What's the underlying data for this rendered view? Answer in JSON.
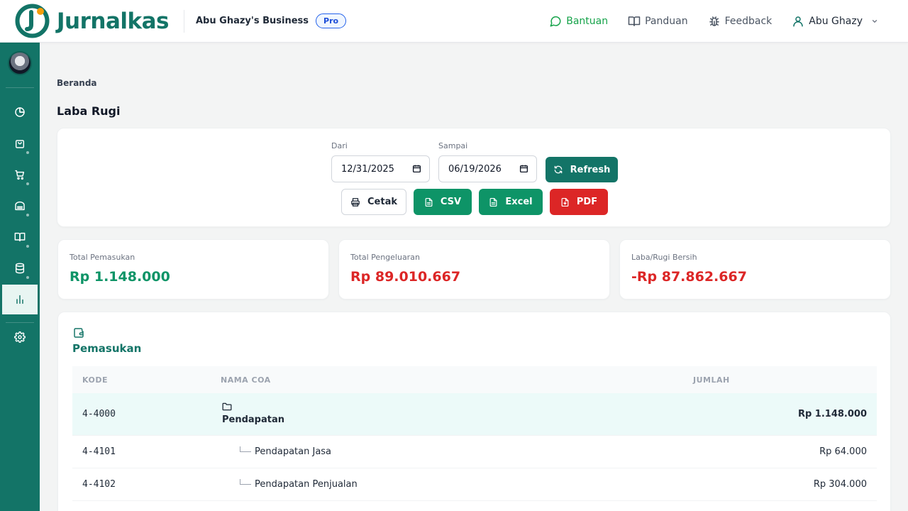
{
  "brand": {
    "name": "Jurnalkas"
  },
  "header": {
    "business_name": "Abu Ghazy's Business",
    "plan_badge": "Pro",
    "help": "Bantuan",
    "guide": "Panduan",
    "feedback": "Feedback",
    "user_name": "Abu Ghazy"
  },
  "sidebar": {
    "items": [
      {
        "icon": "chart-pie-icon"
      },
      {
        "icon": "shopping-bag-icon"
      },
      {
        "icon": "cart-icon"
      },
      {
        "icon": "archive-icon"
      },
      {
        "icon": "book-icon"
      },
      {
        "icon": "database-icon"
      },
      {
        "icon": "bar-chart-icon",
        "active": true
      },
      {
        "icon": "gear-icon"
      }
    ]
  },
  "page": {
    "breadcrumb": "Beranda",
    "title": "Laba Rugi"
  },
  "filter": {
    "from_label": "Dari",
    "from_value": "12/31/2025",
    "to_label": "Sampai",
    "to_value": "06/19/2026",
    "refresh": "Refresh",
    "print": "Cetak",
    "csv": "CSV",
    "excel": "Excel",
    "pdf": "PDF"
  },
  "summary": {
    "income_label": "Total Pemasukan",
    "income_value": "Rp 1.148.000",
    "expense_label": "Total Pengeluaran",
    "expense_value": "Rp 89.010.667",
    "net_label": "Laba/Rugi Bersih",
    "net_value": "-Rp 87.862.667"
  },
  "income_section": {
    "title": "Pemasukan",
    "columns": [
      "KODE",
      "NAMA COA",
      "JUMLAH"
    ],
    "rows": [
      {
        "code": "4-4000",
        "name": "Pendapatan",
        "amount": "Rp 1.148.000"
      },
      {
        "code": "4-4101",
        "name": "Pendapatan Jasa",
        "amount": "Rp 64.000"
      },
      {
        "code": "4-4102",
        "name": "Pendapatan Penjualan",
        "amount": "Rp 304.000"
      }
    ]
  },
  "colors": {
    "brand": "#137467",
    "accent_orange": "#f59e0b",
    "positive": "#0e9467",
    "negative": "#dc2626"
  }
}
